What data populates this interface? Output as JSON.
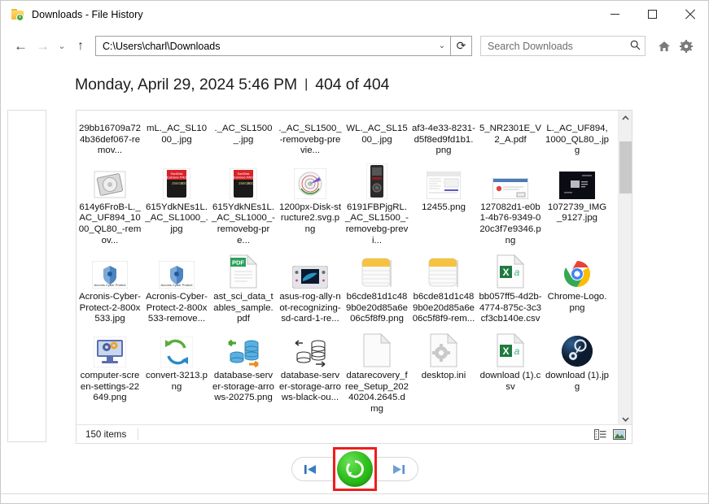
{
  "window": {
    "title": "Downloads - File History",
    "icon": "file-history-folder-icon",
    "minimize_label": "Minimize",
    "maximize_label": "Maximize",
    "close_label": "Close"
  },
  "addressbar": {
    "back_label": "Back",
    "forward_label": "Forward",
    "recent_label": "Recent locations",
    "up_label": "Up one level",
    "path": "C:\\Users\\charl\\Downloads",
    "dropdown_label": "Previous locations",
    "refresh_label": "Refresh",
    "search_placeholder": "Search Downloads",
    "search_value": "",
    "home_label": "Home",
    "settings_label": "Settings"
  },
  "header": {
    "datetime": "Monday, April 29, 2024 5:46 PM",
    "separator": "|",
    "counter": "404 of 404"
  },
  "status": {
    "item_count": "150 items",
    "view_details_label": "Details view",
    "view_large_icons_label": "Large icons view"
  },
  "transport": {
    "previous_label": "Previous version",
    "restore_label": "Restore to original location",
    "next_label": "Next version",
    "highlight_color": "#ef1c1c",
    "restore_color": "#33c320"
  },
  "scrollbar": {
    "up_label": "Scroll up",
    "down_label": "Scroll down",
    "thumb_label": "Vertical scrollbar thumb"
  },
  "files": [
    {
      "name": "29bb16709a724b36def067-remov...",
      "icon": "image-thumb-clipped",
      "clipped": true
    },
    {
      "name": "mL._AC_SL1000_.jpg",
      "icon": "image-thumb-clipped",
      "clipped": true
    },
    {
      "name": "._AC_SL1500_.jpg",
      "icon": "image-thumb-clipped",
      "clipped": true
    },
    {
      "name": "._AC_SL1500_-removebg-previe...",
      "icon": "image-thumb-clipped",
      "clipped": true
    },
    {
      "name": "WL._AC_SL1500_.jpg",
      "icon": "image-thumb-clipped",
      "clipped": true
    },
    {
      "name": "af3-4e33-8231-d5f8ed9fd1b1.png",
      "icon": "image-thumb-clipped",
      "clipped": true
    },
    {
      "name": "5_NR2301E_V2_A.pdf",
      "icon": "image-thumb-clipped",
      "clipped": true
    },
    {
      "name": "L._AC_UF894,1000_QL80_.jpg",
      "icon": "image-thumb-clipped",
      "clipped": true
    },
    {
      "name": "614y6FroB-L._AC_UF894_1000_QL80_-remov...",
      "icon": "hard-drive-thumb",
      "clipped": false
    },
    {
      "name": "615YdkNEs1L._AC_SL1000_.jpg",
      "icon": "sandisk-card-thumb",
      "clipped": false
    },
    {
      "name": "615YdkNEs1L._AC_SL1000_-removebg-pre...",
      "icon": "sandisk-card-thumb",
      "clipped": false
    },
    {
      "name": "1200px-Disk-structure2.svg.png",
      "icon": "disk-structure-thumb",
      "clipped": false
    },
    {
      "name": "6191FBPjgRL._AC_SL1500_-removebg-previ...",
      "icon": "recorder-thumb",
      "clipped": false
    },
    {
      "name": "12455.png",
      "icon": "document-screenshot-thumb",
      "clipped": false
    },
    {
      "name": "127082d1-e0b1-4b76-9349-020c3f7e9346.png",
      "icon": "dialog-screenshot-thumb",
      "clipped": false
    },
    {
      "name": "1072739_IMG_9127.jpg",
      "icon": "dark-photo-thumb",
      "clipped": false
    },
    {
      "name": "Acronis-Cyber-Protect-2-800x533.jpg",
      "icon": "acronis-thumb",
      "clipped": false
    },
    {
      "name": "Acronis-Cyber-Protect-2-800x533-remove...",
      "icon": "acronis-thumb",
      "clipped": false
    },
    {
      "name": "ast_sci_data_tables_sample.pdf",
      "icon": "pdf-file-icon",
      "clipped": false
    },
    {
      "name": "asus-rog-ally-not-recognizing-sd-card-1-re...",
      "icon": "handheld-console-thumb",
      "clipped": false
    },
    {
      "name": "b6cde81d1c489b0e20d85a6e06c5f8f9.png",
      "icon": "notes-app-thumb",
      "clipped": false
    },
    {
      "name": "b6cde81d1c489b0e20d85a6e06c5f8f9-rem...",
      "icon": "notes-app-thumb",
      "clipped": false
    },
    {
      "name": "bb057ff5-4d2b-4774-875c-3c3cf3cb140e.csv",
      "icon": "excel-csv-icon",
      "clipped": false
    },
    {
      "name": "Chrome-Logo.png",
      "icon": "chrome-logo-thumb",
      "clipped": false
    },
    {
      "name": "computer-screen-settings-22649.png",
      "icon": "monitor-settings-thumb",
      "clipped": false
    },
    {
      "name": "convert-3213.png",
      "icon": "convert-arrows-thumb",
      "clipped": false
    },
    {
      "name": "database-server-storage-arrows-20275.png",
      "icon": "database-arrows-thumb",
      "clipped": false
    },
    {
      "name": "database-server-storage-arrows-black-ou...",
      "icon": "database-arrows-outline-thumb",
      "clipped": false
    },
    {
      "name": "datarecovery_free_Setup_20240204.2645.dmg",
      "icon": "blank-file-icon",
      "clipped": false
    },
    {
      "name": "desktop.ini",
      "icon": "ini-gear-file-icon",
      "clipped": false
    },
    {
      "name": "download (1).csv",
      "icon": "excel-csv-icon",
      "clipped": false
    },
    {
      "name": "download (1).jpg",
      "icon": "steam-logo-thumb",
      "clipped": false
    }
  ]
}
